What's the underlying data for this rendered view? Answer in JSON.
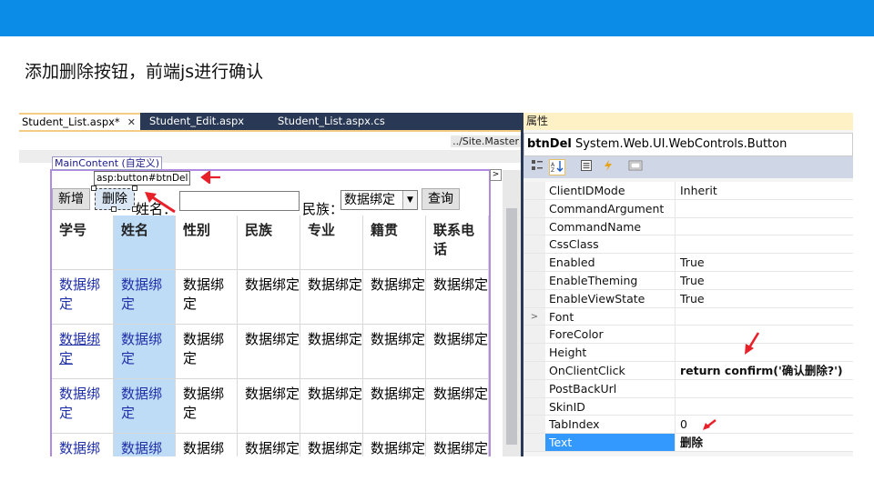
{
  "slide": {
    "title": "添加删除按钮，前端js进行确认",
    "accent": "#0b8ce6"
  },
  "designer": {
    "tabs": [
      {
        "label": "Student_List.aspx*",
        "active": true,
        "close": "✕"
      },
      {
        "label": "Student_Edit.aspx",
        "active": false
      },
      {
        "label": "Student_List.aspx.cs",
        "active": false
      }
    ],
    "master_label": "../Site.Master",
    "content_tag": "MainContent (自定义)",
    "tooltip": "asp:button#btnDel",
    "expand_glyph": ">",
    "toolbar": {
      "add_label": "新增",
      "delete_label": "删除",
      "name_label": "姓名：",
      "ethnic_label": "民族：",
      "dropdown_value": "数据绑定",
      "dropdown_arrow": "▼",
      "query_label": "查询"
    },
    "grid": {
      "headers": [
        "学号",
        "姓名",
        "性别",
        "民族",
        "专业",
        "籍贯",
        "联系电话"
      ],
      "cell_text": "数据绑定",
      "row_count": 4
    }
  },
  "properties": {
    "panel_title": "属性",
    "object_name": "btnDel",
    "object_type": "System.Web.UI.WebControls.Button",
    "rows": [
      {
        "name": "ClientIDMode",
        "value": "Inherit"
      },
      {
        "name": "CommandArgument",
        "value": ""
      },
      {
        "name": "CommandName",
        "value": ""
      },
      {
        "name": "CssClass",
        "value": ""
      },
      {
        "name": "Enabled",
        "value": "True"
      },
      {
        "name": "EnableTheming",
        "value": "True"
      },
      {
        "name": "EnableViewState",
        "value": "True"
      },
      {
        "name": "Font",
        "value": "",
        "expand": ">"
      },
      {
        "name": "ForeColor",
        "value": ""
      },
      {
        "name": "Height",
        "value": ""
      },
      {
        "name": "OnClientClick",
        "value": "return confirm('确认删除?')"
      },
      {
        "name": "PostBackUrl",
        "value": ""
      },
      {
        "name": "SkinID",
        "value": ""
      },
      {
        "name": "TabIndex",
        "value": "0"
      },
      {
        "name": "Text",
        "value": "删除"
      }
    ]
  },
  "annotation_color": "#e8202a"
}
